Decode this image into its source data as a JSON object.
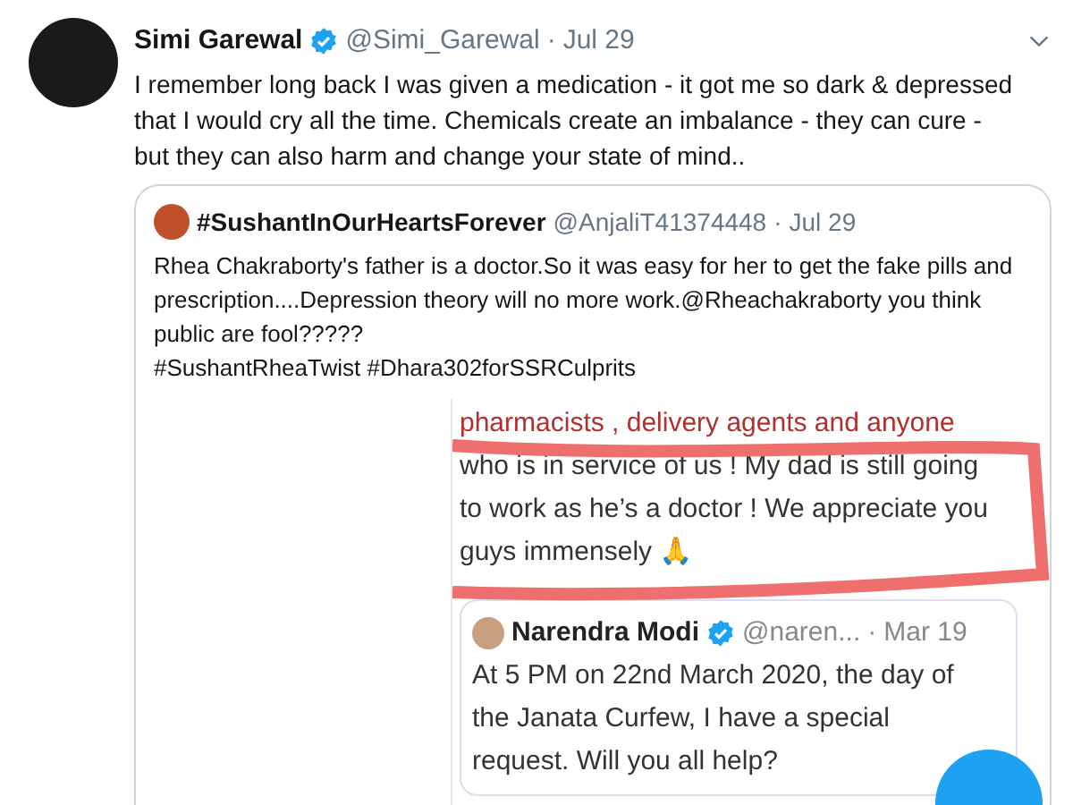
{
  "tweet": {
    "name": "Simi Garewal",
    "verified": true,
    "handle": "@Simi_Garewal",
    "separator": "·",
    "date": "Jul 29",
    "text": "I remember long back I was given a medication - it got me so dark & depressed that I would cry all the time. Chemicals create an imbalance - they can cure - but they can also harm and change your state of mind.."
  },
  "quoted": {
    "name": "#SushantInOurHeartsForever",
    "handle": "@AnjaliT41374448",
    "separator": "·",
    "date": "Jul 29",
    "text": "Rhea Chakraborty's father is a doctor.So it was easy for her to get the fake pills and prescription....Depression theory will no more work.@Rheachakraborty you think public are fool?????",
    "hashtags": "#SushantRheaTwist #Dhara302forSSRCulprits"
  },
  "image": {
    "lines": [
      "pharmacists , delivery agents and anyone",
      "who is in service of us ! My dad is still going",
      "to work as he’s a doctor ! We appreciate you",
      "guys immensely 🙏"
    ],
    "inner": {
      "name": "Narendra Modi",
      "verified": true,
      "handle": "@naren...",
      "separator": "·",
      "date": "Mar 19",
      "lines": [
        "At 5 PM on 22nd March 2020, the day of",
        "the Janata Curfew, I have a special",
        "request. Will you all help?"
      ]
    }
  }
}
